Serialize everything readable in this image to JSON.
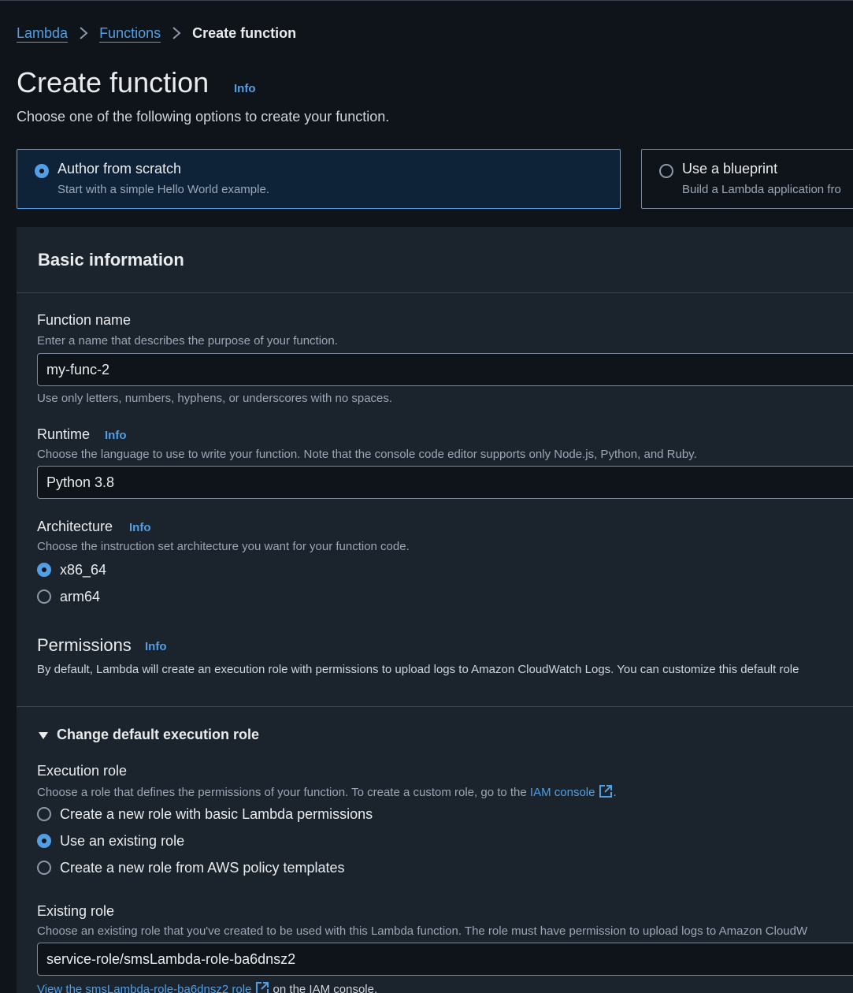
{
  "breadcrumb": {
    "items": [
      "Lambda",
      "Functions"
    ],
    "current": "Create function"
  },
  "header": {
    "title": "Create function",
    "info": "Info",
    "description": "Choose one of the following options to create your function."
  },
  "options": {
    "author": {
      "title": "Author from scratch",
      "subtitle": "Start with a simple Hello World example.",
      "selected": true
    },
    "blueprint": {
      "title": "Use a blueprint",
      "subtitle": "Build a Lambda application fro",
      "selected": false
    }
  },
  "basic_info": {
    "title": "Basic information",
    "function_name": {
      "label": "Function name",
      "description": "Enter a name that describes the purpose of your function.",
      "value": "my-func-2",
      "constraint": "Use only letters, numbers, hyphens, or underscores with no spaces."
    },
    "runtime": {
      "label": "Runtime",
      "info": "Info",
      "description": "Choose the language to use to write your function. Note that the console code editor supports only Node.js, Python, and Ruby.",
      "value": "Python 3.8"
    },
    "architecture": {
      "label": "Architecture",
      "info": "Info",
      "description": "Choose the instruction set architecture you want for your function code.",
      "options": [
        "x86_64",
        "arm64"
      ],
      "selected": "x86_64"
    },
    "permissions": {
      "title": "Permissions",
      "info": "Info",
      "description": "By default, Lambda will create an execution role with permissions to upload logs to Amazon CloudWatch Logs. You can customize this default role"
    }
  },
  "execution_role": {
    "toggle_label": "Change default execution role",
    "label": "Execution role",
    "description_prefix": "Choose a role that defines the permissions of your function. To create a custom role, go to the",
    "iam_link": "IAM console",
    "description_suffix": ".",
    "options": [
      "Create a new role with basic Lambda permissions",
      "Use an existing role",
      "Create a new role from AWS policy templates"
    ],
    "selected": "Use an existing role"
  },
  "existing_role": {
    "label": "Existing role",
    "description": "Choose an existing role that you've created to be used with this Lambda function. The role must have permission to upload logs to Amazon CloudW",
    "value": "service-role/smsLambda-role-ba6dnsz2",
    "view_link": "View the smsLambda-role-ba6dnsz2 role",
    "view_suffix": "on the IAM console."
  },
  "colors": {
    "accent": "#539fe5",
    "background": "#0f141a",
    "panel": "#1b232d",
    "selected_tile": "#0e2338"
  },
  "icons": [
    "chevron-right-icon",
    "radio-selected-icon",
    "radio-unselected-icon",
    "caret-down-icon",
    "external-link-icon"
  ]
}
